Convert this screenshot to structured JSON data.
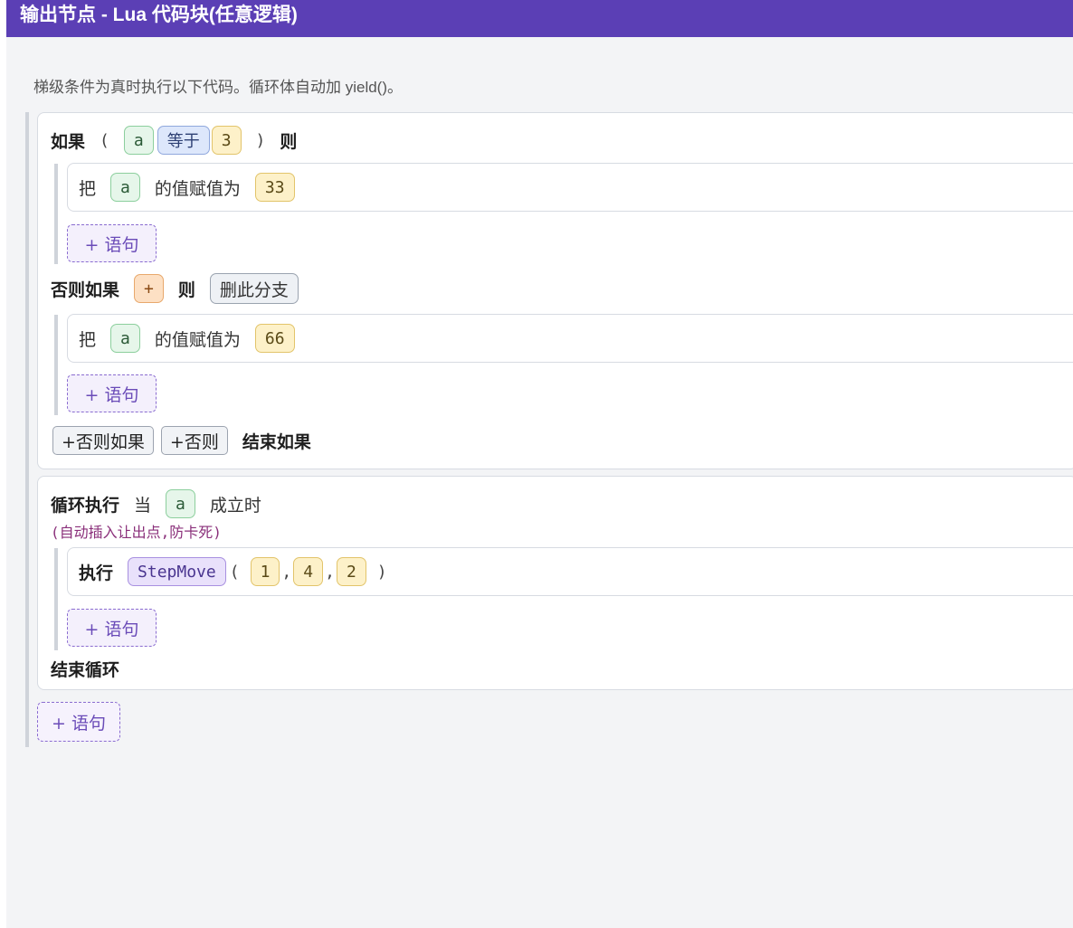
{
  "title": "输出节点 - Lua 代码块(任意逻辑)",
  "description": "梯级条件为真时执行以下代码。循环体自动加 yield()。",
  "if_block": {
    "if_kw": "如果",
    "open_paren": "(",
    "close_paren": ")",
    "then_kw": "则",
    "cond_var": "a",
    "cond_op": "等于",
    "cond_value": "3",
    "body_stmt": {
      "prefix": "把",
      "var": "a",
      "mid": "的值赋值为",
      "value": "33"
    },
    "add_stmt": "+ 语句",
    "elseif_kw": "否则如果",
    "elseif_plus": "+",
    "elseif_then": "则",
    "delete_branch": "删此分支",
    "elseif_stmt": {
      "prefix": "把",
      "var": "a",
      "mid": "的值赋值为",
      "value": "66"
    },
    "elseif_add_stmt": "+ 语句",
    "add_elseif": "+否则如果",
    "add_else": "+否则",
    "end_if": "结束如果"
  },
  "loop_block": {
    "loop_kw": "循环执行",
    "while_kw": "当",
    "cond_var": "a",
    "holds_kw": "成立时",
    "note": "(自动插入让出点,防卡死)",
    "exec_kw": "执行",
    "func": "StepMove",
    "open_paren": "(",
    "close_paren": ")",
    "comma": ",",
    "args": [
      "1",
      "4",
      "2"
    ],
    "add_stmt": "+ 语句",
    "end_loop": "结束循环"
  },
  "root_add_stmt": "+ 语句"
}
